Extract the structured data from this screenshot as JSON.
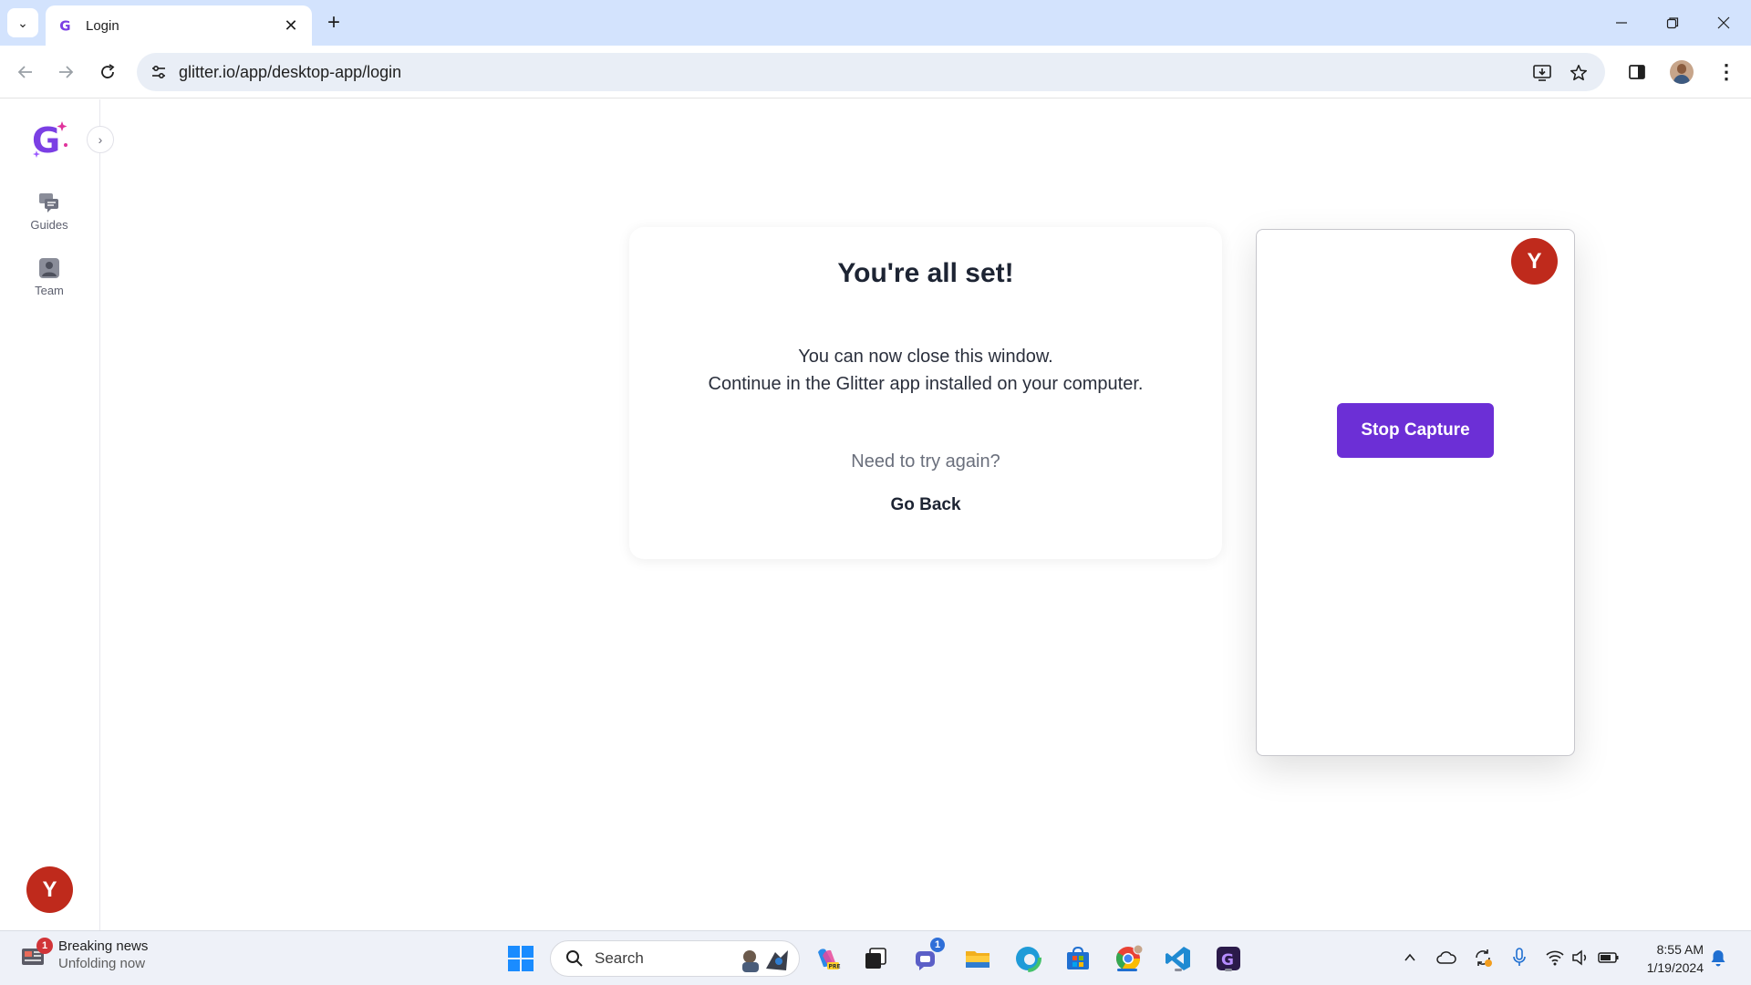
{
  "browser": {
    "tab_title": "Login",
    "url": "glitter.io/app/desktop-app/login",
    "new_tab_label": "+"
  },
  "sidebar": {
    "items": [
      {
        "label": "Guides",
        "icon": "guides-icon"
      },
      {
        "label": "Team",
        "icon": "team-icon"
      }
    ],
    "user_initial": "Y",
    "collapse_glyph": "›"
  },
  "card": {
    "title": "You're all set!",
    "message_line1": "You can now close this window.",
    "message_line2": "Continue in the Glitter app installed on your computer.",
    "retry_question": "Need to try again?",
    "go_back_label": "Go Back"
  },
  "capture": {
    "user_initial": "Y",
    "stop_label": "Stop Capture"
  },
  "taskbar": {
    "news_title": "Breaking news",
    "news_subtitle": "Unfolding now",
    "news_badge": "1",
    "search_label": "Search",
    "chat_badge": "1",
    "time": "8:55 AM",
    "date": "1/19/2024"
  },
  "colors": {
    "brand_purple": "#6c2fd6",
    "avatar_red": "#bf2a1c",
    "chrome_blue": "#d3e3fd"
  }
}
